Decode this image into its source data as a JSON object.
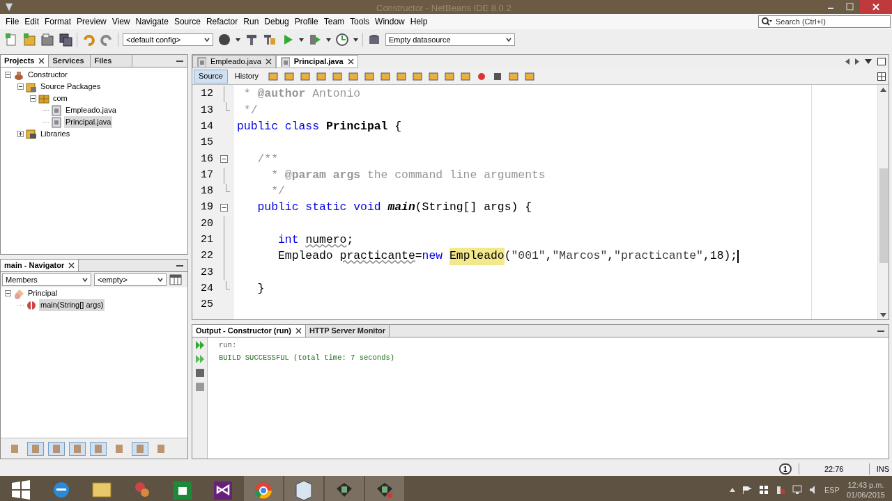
{
  "window": {
    "title": "Constructor - NetBeans IDE 8.0.2"
  },
  "menu": [
    "File",
    "Edit",
    "Format",
    "Preview",
    "View",
    "Navigate",
    "Source",
    "Refactor",
    "Run",
    "Debug",
    "Profile",
    "Team",
    "Tools",
    "Window",
    "Help"
  ],
  "search": {
    "placeholder": "Search (Ctrl+I)"
  },
  "toolbar": {
    "config": "<default config>",
    "datasource": "Empty datasource"
  },
  "projects_panel": {
    "tabs": [
      {
        "label": "Projects",
        "selected": true,
        "closable": true
      },
      {
        "label": "Services",
        "selected": false,
        "closable": false
      },
      {
        "label": "Files",
        "selected": false,
        "closable": false
      }
    ],
    "tree": [
      {
        "label": "Constructor",
        "kind": "project",
        "expanded": true,
        "selected": false,
        "children": [
          {
            "label": "Source Packages",
            "kind": "sources",
            "expanded": true,
            "selected": false,
            "children": [
              {
                "label": "com",
                "kind": "package",
                "expanded": true,
                "selected": false,
                "children": [
                  {
                    "label": "Empleado.java",
                    "kind": "file",
                    "selected": false
                  },
                  {
                    "label": "Principal.java",
                    "kind": "file",
                    "selected": true
                  }
                ]
              }
            ]
          },
          {
            "label": "Libraries",
            "kind": "libraries",
            "expanded": false,
            "selected": false
          }
        ]
      }
    ]
  },
  "navigator": {
    "title": "main - Navigator",
    "filter": "Members",
    "scope": "<empty>",
    "tree": [
      {
        "label": "Principal",
        "kind": "class",
        "expanded": true,
        "selected": false,
        "children": [
          {
            "label": "main(String[] args)",
            "kind": "method",
            "selected": true
          }
        ]
      }
    ]
  },
  "editor": {
    "tabs": [
      {
        "label": "Empleado.java",
        "selected": false
      },
      {
        "label": "Principal.java",
        "selected": true
      }
    ],
    "views": [
      {
        "label": "Source",
        "selected": true
      },
      {
        "label": "History",
        "selected": false
      }
    ],
    "lines": [
      {
        "number": "12",
        "kind": "fold-line",
        "cursor": false,
        "tokens": [
          {
            "text": " * ",
            "kind": "comment"
          },
          {
            "text": "@author",
            "kind": "tag"
          },
          {
            "text": " Antonio",
            "kind": "comment"
          }
        ]
      },
      {
        "number": "13",
        "kind": "fold-end",
        "cursor": false,
        "tokens": [
          {
            "text": " */",
            "kind": "comment"
          }
        ]
      },
      {
        "number": "14",
        "kind": "plain",
        "cursor": false,
        "tokens": [
          {
            "text": "public class ",
            "kind": "keyword"
          },
          {
            "text": "Principal",
            "kind": "declaration"
          },
          {
            "text": " {",
            "kind": "plain"
          }
        ]
      },
      {
        "number": "15",
        "kind": "plain",
        "cursor": false
      },
      {
        "number": "16",
        "kind": "fold-start",
        "cursor": false,
        "tokens": [
          {
            "text": "   /**",
            "kind": "comment"
          }
        ]
      },
      {
        "number": "17",
        "kind": "fold-line",
        "cursor": false,
        "tokens": [
          {
            "text": "     * ",
            "kind": "comment"
          },
          {
            "text": "@param",
            "kind": "tag"
          },
          {
            "text": " args",
            "kind": "tag"
          },
          {
            "text": " the command line arguments",
            "kind": "comment"
          }
        ]
      },
      {
        "number": "18",
        "kind": "fold-end",
        "cursor": false,
        "tokens": [
          {
            "text": "     */",
            "kind": "comment"
          }
        ]
      },
      {
        "number": "19",
        "kind": "fold-start",
        "cursor": false,
        "tokens": [
          {
            "text": "   public static void ",
            "kind": "keyword"
          },
          {
            "text": "main",
            "kind": "method"
          },
          {
            "text": "(String[] args) {",
            "kind": "plain"
          }
        ]
      },
      {
        "number": "20",
        "kind": "fold-line",
        "cursor": false
      },
      {
        "number": "21",
        "kind": "fold-line",
        "cursor": false,
        "tokens": [
          {
            "text": "      int ",
            "kind": "keyword"
          },
          {
            "text": "numero",
            "kind": "warning"
          },
          {
            "text": ";",
            "kind": "plain"
          }
        ]
      },
      {
        "number": "22",
        "kind": "fold-line",
        "cursor": true,
        "tokens": [
          {
            "text": "      Empleado ",
            "kind": "plain"
          },
          {
            "text": "practicante",
            "kind": "warning"
          },
          {
            "text": "=",
            "kind": "plain"
          },
          {
            "text": "new ",
            "kind": "keyword"
          },
          {
            "text": "Empleado",
            "kind": "highlight"
          },
          {
            "text": "(",
            "kind": "plain"
          },
          {
            "text": "\"001\"",
            "kind": "string"
          },
          {
            "text": ",",
            "kind": "plain"
          },
          {
            "text": "\"Marcos\"",
            "kind": "string"
          },
          {
            "text": ",",
            "kind": "plain"
          },
          {
            "text": "\"practicante\"",
            "kind": "string"
          },
          {
            "text": ",",
            "kind": "plain"
          },
          {
            "text": "18",
            "kind": "number"
          },
          {
            "text": ");",
            "kind": "plain"
          }
        ]
      },
      {
        "number": "23",
        "kind": "fold-line",
        "cursor": false
      },
      {
        "number": "24",
        "kind": "fold-end",
        "cursor": false,
        "tokens": [
          {
            "text": "   }",
            "kind": "plain"
          }
        ]
      },
      {
        "number": "25",
        "kind": "plain",
        "cursor": false
      }
    ]
  },
  "output": {
    "tabs": [
      {
        "label": "Output - Constructor (run)",
        "selected": true,
        "closable": true
      },
      {
        "label": "HTTP Server Monitor",
        "selected": false,
        "closable": false
      }
    ],
    "lines": [
      {
        "text": "run:",
        "kind": "info"
      },
      {
        "text": "BUILD SUCCESSFUL (total time: 7 seconds)",
        "kind": "success"
      }
    ]
  },
  "status_bar": {
    "notifications": "1",
    "position": "22:76",
    "mode": "INS"
  },
  "taskbar": {
    "apps": [
      {
        "kind": "start",
        "running": false
      },
      {
        "kind": "browser",
        "running": false
      },
      {
        "kind": "folder",
        "running": false
      },
      {
        "kind": "swirl",
        "running": false
      },
      {
        "kind": "store",
        "running": false
      },
      {
        "kind": "studio",
        "running": false
      },
      {
        "kind": "chrome",
        "running": true
      },
      {
        "kind": "cube",
        "running": true
      },
      {
        "kind": "monitor",
        "running": true
      },
      {
        "kind": "monitor-red",
        "running": true
      }
    ],
    "language": "ESP",
    "time": "12:43 p.m.",
    "date": "01/06/2015"
  }
}
